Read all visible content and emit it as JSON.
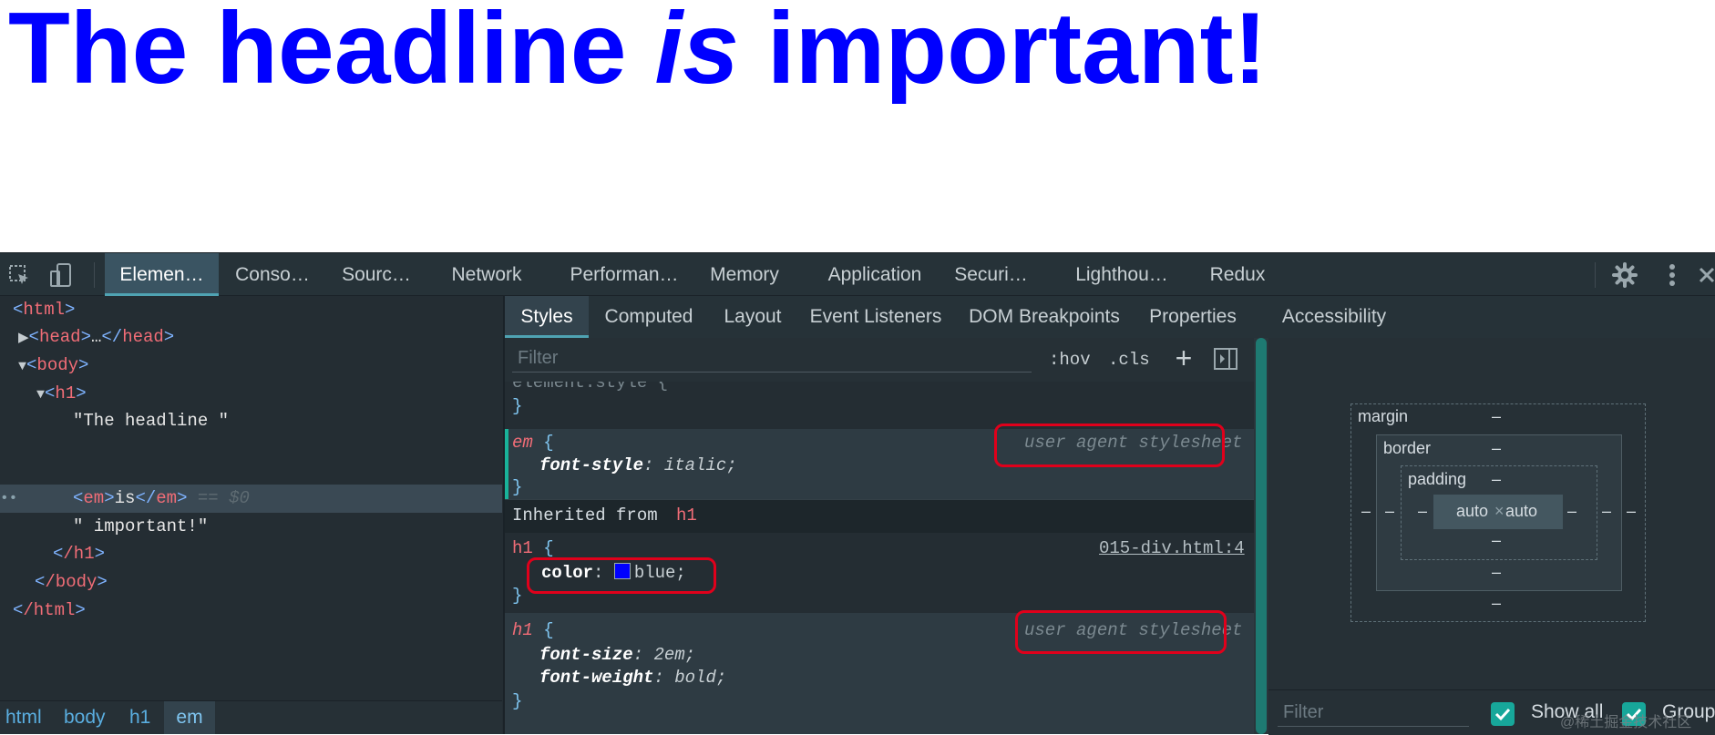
{
  "page": {
    "headline_part1": "The headline ",
    "headline_em": "is",
    "headline_part2": " important!"
  },
  "devtools": {
    "top_tabs": [
      {
        "label": "Elemen…",
        "active": true
      },
      {
        "label": "Conso…"
      },
      {
        "label": "Sourc…"
      },
      {
        "label": "Network"
      },
      {
        "label": "Performan…"
      },
      {
        "label": "Memory"
      },
      {
        "label": "Application"
      },
      {
        "label": "Securi…"
      },
      {
        "label": "Lighthou…"
      },
      {
        "label": "Redux"
      }
    ],
    "icons": [
      "inspect-element-icon",
      "device-toolbar-icon",
      "gear-icon",
      "more-vert-icon",
      "close-icon"
    ],
    "dom_tree": {
      "html_open": "html",
      "head": "head",
      "head_ellipsis": "…",
      "body": "body",
      "h1": "h1",
      "text1": "\"The headline \"",
      "em": "em",
      "em_text": "is",
      "dollar": "== $0",
      "text2": "\" important!\"",
      "h1_close": "/h1",
      "body_close": "/body",
      "html_close": "/html"
    },
    "breadcrumbs": [
      "html",
      "body",
      "h1",
      "em"
    ],
    "sub_tabs": [
      {
        "label": "Styles",
        "active": true
      },
      {
        "label": "Computed"
      },
      {
        "label": "Layout"
      },
      {
        "label": "Event Listeners"
      },
      {
        "label": "DOM Breakpoints"
      },
      {
        "label": "Properties"
      },
      {
        "label": "Accessibility"
      }
    ],
    "filter_placeholder": "Filter",
    "hov_label": ":hov",
    "cls_label": ".cls",
    "plus_label": "+",
    "styles": {
      "element_style_label": "element.style {",
      "element_style_close": "}",
      "rule_em": {
        "selector": "em",
        "open": "{",
        "property": "font-style",
        "value": "italic;",
        "close": "}",
        "source": "user agent stylesheet"
      },
      "inherited_label": "Inherited from",
      "inherited_tag": "h1",
      "rule_h1_author": {
        "selector": "h1",
        "open": "{",
        "property": "color",
        "value": "blue;",
        "swatch_color": "#0000ff",
        "close": "}",
        "source": "015-div.html:4"
      },
      "rule_h1_ua": {
        "selector": "h1",
        "open": "{",
        "property1": "font-size",
        "value1": "2em;",
        "property2": "font-weight",
        "value2": "bold;",
        "close": "}",
        "source": "user agent stylesheet"
      }
    },
    "box_model": {
      "margin_label": "margin",
      "border_label": "border",
      "padding_label": "padding",
      "dash": "–",
      "content_width": "auto",
      "content_times": "×",
      "content_height": "auto"
    },
    "computed_filter_placeholder": "Filter",
    "show_all_label": "Show all",
    "group_label": "Group"
  },
  "watermark": "@稀土掘金技术社区",
  "colors": {
    "headline": "#0000ff",
    "devtools_bg": "#242d33",
    "accent": "#4fa3b3",
    "tag": "#f16d77",
    "highlight_box": "#e0001b",
    "checkbox": "#17a79a"
  }
}
